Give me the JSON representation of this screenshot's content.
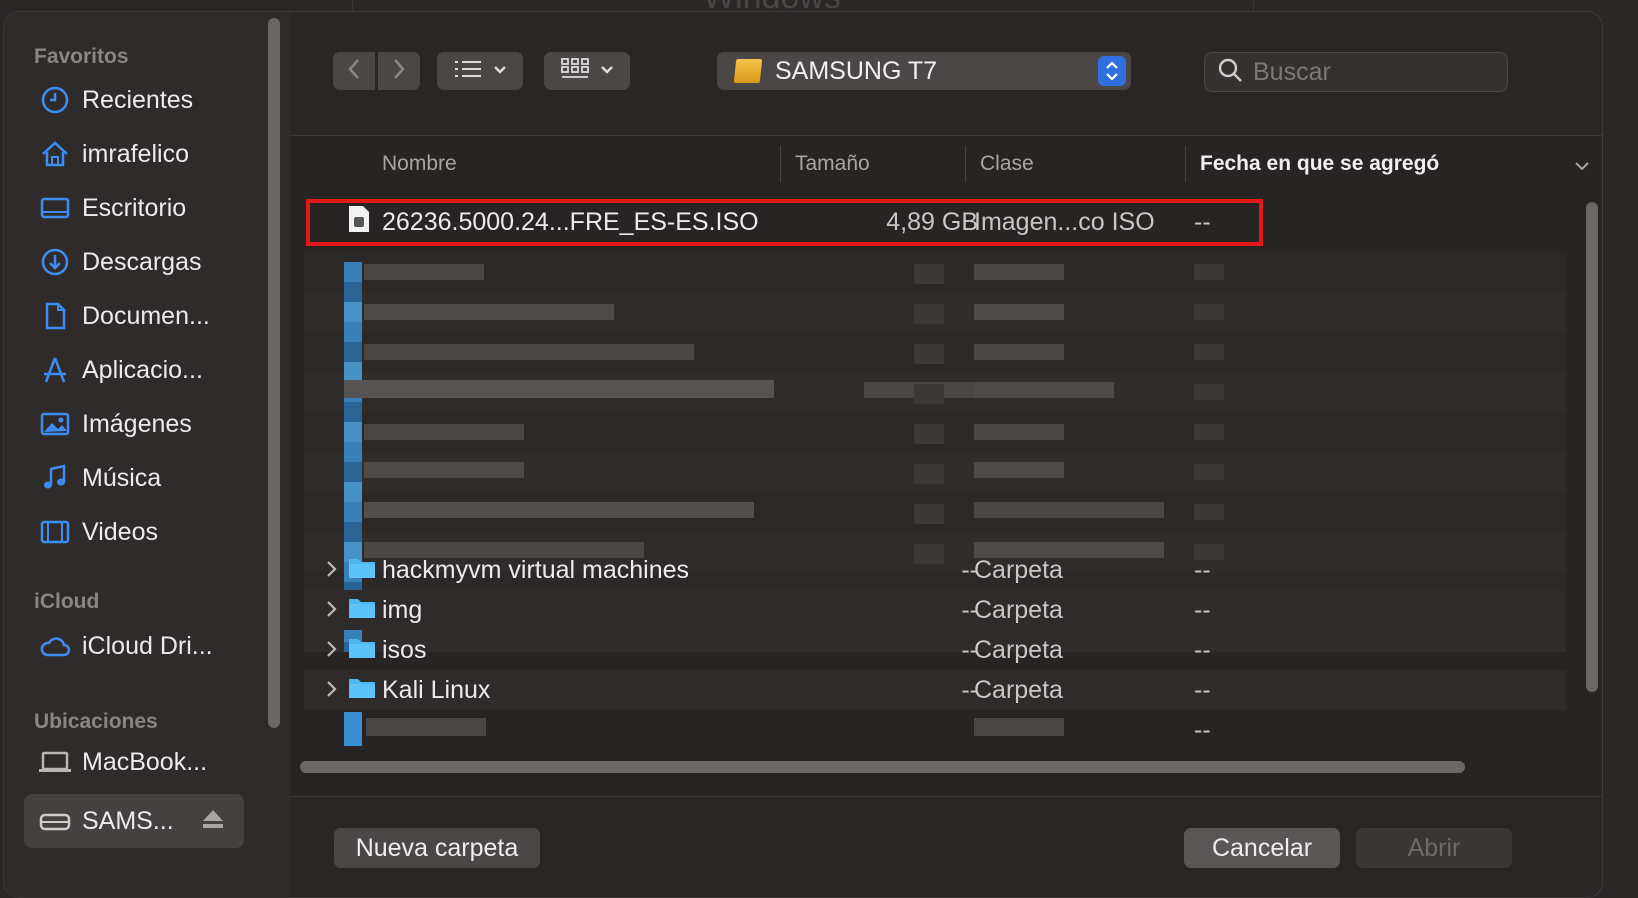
{
  "background_window": {
    "title_fragment": "Windows"
  },
  "sidebar": {
    "sections": [
      {
        "title": "Favoritos"
      },
      {
        "title": "iCloud"
      },
      {
        "title": "Ubicaciones"
      }
    ],
    "items": [
      {
        "label": "Recientes",
        "icon": "clock-icon"
      },
      {
        "label": "imrafelico",
        "icon": "home-icon"
      },
      {
        "label": "Escritorio",
        "icon": "desktop-icon"
      },
      {
        "label": "Descargas",
        "icon": "download-icon"
      },
      {
        "label": "Documen...",
        "icon": "document-icon"
      },
      {
        "label": "Aplicacio...",
        "icon": "applications-icon"
      },
      {
        "label": "Imágenes",
        "icon": "pictures-icon"
      },
      {
        "label": "Música",
        "icon": "music-icon"
      },
      {
        "label": "Videos",
        "icon": "film-icon"
      },
      {
        "label": "iCloud Dri...",
        "icon": "cloud-icon"
      },
      {
        "label": "MacBook...",
        "icon": "laptop-icon"
      },
      {
        "label": "SAMS...",
        "icon": "drive-icon",
        "selected": true
      }
    ]
  },
  "toolbar": {
    "location": "SAMSUNG T7",
    "search_placeholder": "Buscar"
  },
  "columns": {
    "name": "Nombre",
    "size": "Tamaño",
    "kind": "Clase",
    "date_added": "Fecha en que se agregó"
  },
  "files": {
    "highlighted": {
      "name": "26236.5000.24...FRE_ES-ES.ISO",
      "size": "4,89 GB",
      "kind": "Imagen...co ISO",
      "date": "--"
    },
    "folders": [
      {
        "name": "hackmyvm virtual machines",
        "size": "--",
        "kind": "Carpeta",
        "date": "--"
      },
      {
        "name": "img",
        "size": "--",
        "kind": "Carpeta",
        "date": "--"
      },
      {
        "name": "isos",
        "size": "--",
        "kind": "Carpeta",
        "date": "--"
      },
      {
        "name": "Kali Linux",
        "size": "--",
        "kind": "Carpeta",
        "date": "--"
      }
    ],
    "last_row_date": "--"
  },
  "buttons": {
    "new_folder": "Nueva carpeta",
    "cancel": "Cancelar",
    "open": "Abrir"
  },
  "colors": {
    "accent": "#2f6fe0",
    "highlight_border": "#e11919",
    "folder": "#4fb6ef"
  }
}
